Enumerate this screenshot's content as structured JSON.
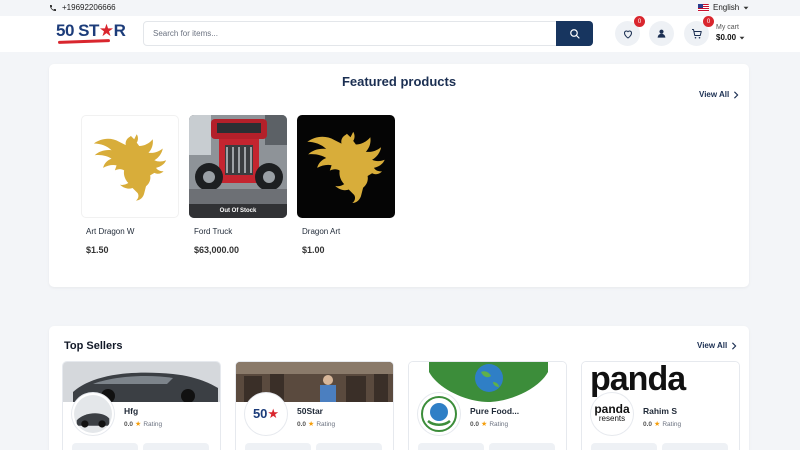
{
  "topbar": {
    "phone": "+19692206666",
    "language": "English"
  },
  "header": {
    "logo_main": "50 ST",
    "logo_star": "★",
    "logo_end": "R",
    "search_placeholder": "Search for items...",
    "wishlist_count": "0",
    "cart_count": "0",
    "cart_label": "My cart",
    "cart_amount": "$0.00"
  },
  "featured": {
    "title": "Featured products",
    "view_all": "View All",
    "products": [
      {
        "name": "Art Dragon W",
        "price": "$1.50",
        "stock_label": ""
      },
      {
        "name": "Ford Truck",
        "price": "$63,000.00",
        "stock_label": "Out Of Stock"
      },
      {
        "name": "Dragon Art",
        "price": "$1.00",
        "stock_label": ""
      }
    ]
  },
  "sellers": {
    "title": "Top Sellers",
    "view_all": "View All",
    "rating_label": "Rating",
    "items": [
      {
        "name": "Hfg",
        "rating": "0.0"
      },
      {
        "name": "50Star",
        "rating": "0.0"
      },
      {
        "name": "Pure Food...",
        "rating": "0.0"
      },
      {
        "name": "Rahim S",
        "rating": "0.0"
      }
    ],
    "panda_text": "panda",
    "panda_sub": "resents"
  },
  "colors": {
    "brand_navy": "#17355f",
    "brand_red": "#d9262e",
    "dragon_gold": "#d8ad3a",
    "star_amber": "#f59e0b"
  },
  "icons": [
    "phone-icon",
    "flag-us-icon",
    "caret-down-icon",
    "search-icon",
    "heart-icon",
    "user-icon",
    "cart-icon",
    "chevron-right-icon",
    "star-icon"
  ]
}
